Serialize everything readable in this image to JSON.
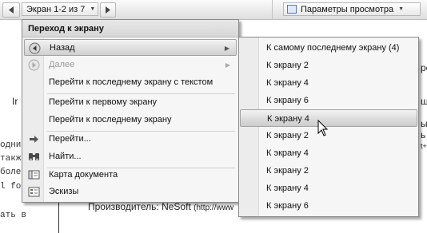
{
  "toolbar": {
    "page_selector": "Экран 1-2 из 7",
    "view_options": "Параметры просмотра"
  },
  "background_text": {
    "left_fragments": [
      "Ir",
      "одни",
      "такж",
      "боле",
      "l folder",
      "ать в"
    ],
    "right_fragments": [
      "ре",
      "ш",
      "ы",
      "ь",
      "t+"
    ],
    "producer_label": "Производитель: NeSoft",
    "producer_url": "(http://www"
  },
  "menu": {
    "title": "Переход к экрану",
    "items": [
      {
        "label": "Назад",
        "icon": "back-arrow-icon",
        "submenu": true,
        "highlighted": true
      },
      {
        "label": "Далее",
        "icon": "forward-arrow-icon",
        "submenu": true,
        "disabled": true
      },
      {
        "label": "Перейти к последнему экрану с текстом"
      },
      {
        "label": "Перейти к первому экрану"
      },
      {
        "label": "Перейти к последнему экрану"
      },
      {
        "label": "Перейти...",
        "icon": "goto-arrow-icon"
      },
      {
        "label": "Найти...",
        "icon": "binoculars-icon"
      },
      {
        "label": "Карта документа",
        "icon": "document-map-icon"
      },
      {
        "label": "Эскизы",
        "icon": "thumbnails-icon"
      }
    ]
  },
  "submenu": {
    "items": [
      "К самому последнему экрану (4)",
      "К экрану 2",
      "К экрану 4",
      "К экрану 6",
      "К экрану 4",
      "К экрану 2",
      "К экрану 4",
      "К экрану 2",
      "К экрану 4",
      "К экрану 6"
    ],
    "highlighted_index": 4
  }
}
